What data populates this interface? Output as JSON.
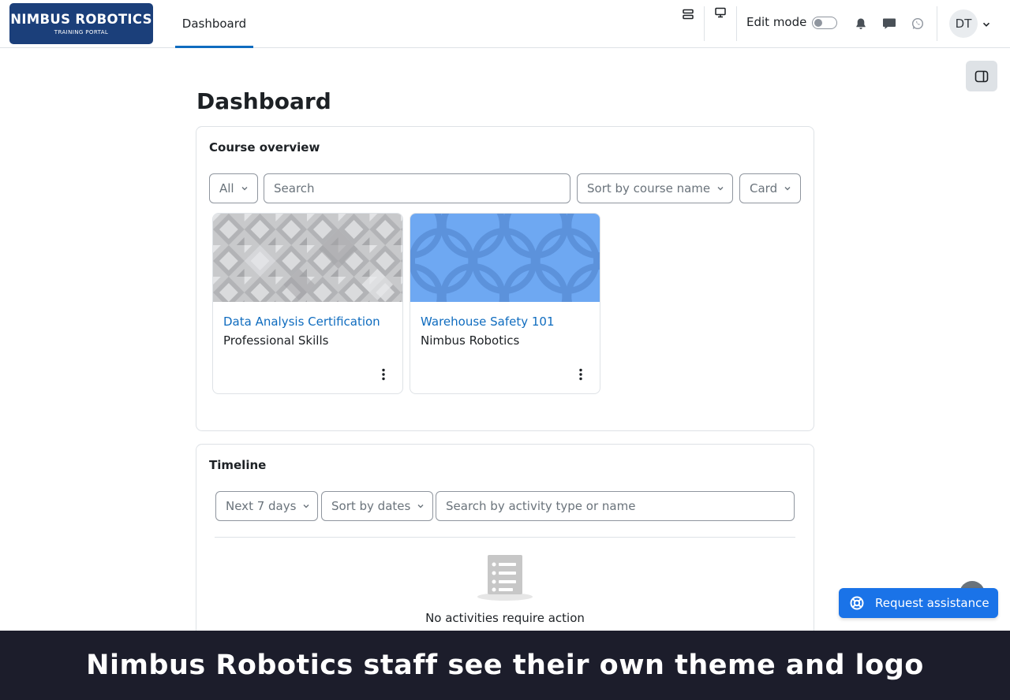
{
  "logo": {
    "main": "NIMBUS ROBOTICS",
    "sub": "TRAINING PORTAL",
    "bg_color": "#1b3f7a"
  },
  "nav": {
    "tab_dashboard": "Dashboard",
    "edit_mode_label": "Edit mode",
    "edit_mode_on": false,
    "avatar_initials": "DT",
    "icons": [
      "course-index-icon",
      "monitor-icon",
      "bell-icon",
      "messages-icon",
      "whatsapp-icon",
      "chevron-down-icon"
    ]
  },
  "page": {
    "title": "Dashboard"
  },
  "course_overview": {
    "title": "Course overview",
    "filter_value": "All",
    "search_placeholder": "Search",
    "sort_value": "Sort by course name",
    "view_value": "Card",
    "courses": [
      {
        "name": "Data Analysis Certification",
        "category": "Professional Skills",
        "pattern": "grey-diamonds"
      },
      {
        "name": "Warehouse Safety 101",
        "category": "Nimbus Robotics",
        "pattern": "blue-circles"
      }
    ]
  },
  "timeline": {
    "title": "Timeline",
    "range_value": "Next 7 days",
    "sort_value": "Sort by dates",
    "search_placeholder": "Search by activity type or name",
    "empty_text": "No activities require action"
  },
  "assist": {
    "label": "Request assistance"
  },
  "caption": {
    "text": "Nimbus Robotics staff see their own theme and logo"
  },
  "colors": {
    "link": "#0f6cbf",
    "primary_button": "#1a73e8",
    "caption_bg": "#1c1d2b"
  }
}
